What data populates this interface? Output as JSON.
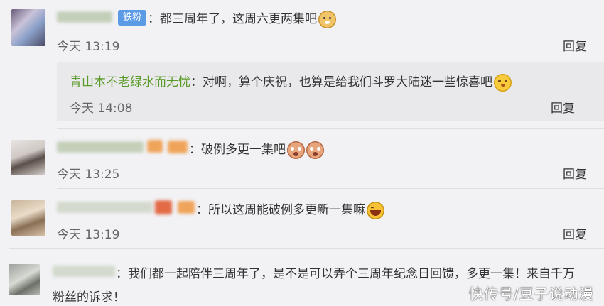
{
  "comments": [
    {
      "badge": "铁粉",
      "text": "：都三周年了，这周六更两集吧",
      "emojis": [
        "dog-emoji"
      ],
      "time": "今天 13:19",
      "reply_label": "回复",
      "sub_reply": {
        "author": "青山本不老绿水而无忧",
        "text": "：对啊，算个庆祝，也算是给我们斗罗大陆迷一些惊喜吧",
        "emojis": [
          "shy-emoji"
        ],
        "time": "今天 14:08",
        "reply_label": "回复"
      }
    },
    {
      "text": "：破例多更一集吧",
      "emojis": [
        "crying-emoji",
        "crying-emoji"
      ],
      "time": "今天 13:25",
      "reply_label": "回复"
    },
    {
      "text": "：所以这周能破例多更新一集嘛",
      "emojis": [
        "laughing-emoji"
      ],
      "time": "今天 13:19",
      "reply_label": "回复"
    },
    {
      "text_line1": "：我们都一起陪伴三周年了，是不是可以弄个三周年纪念日回馈，多更一集！来自千万",
      "text_line2": "粉丝的诉求！"
    }
  ],
  "watermark": "快传号/豆子说动漫",
  "colors": {
    "background": "#f2f2f5",
    "sub_reply_background": "#e9e9ec",
    "sub_author": "#5a9a28",
    "badge": "#5b9be6"
  }
}
